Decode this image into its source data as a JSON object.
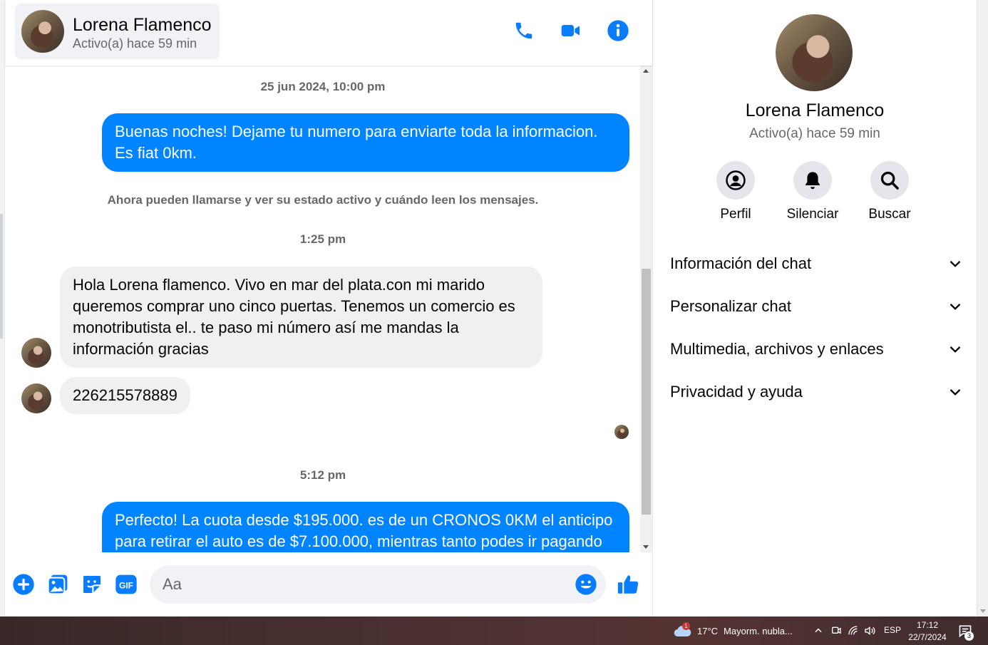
{
  "contact": {
    "name": "Lorena Flamenco",
    "status": "Activo(a) hace 59 min"
  },
  "header": {
    "call_icon": "phone-icon",
    "video_icon": "video-camera-icon",
    "info_icon": "info-icon"
  },
  "messages": {
    "ts1": "25 jun 2024, 10:00 pm",
    "out1_line1": "Buenas noches! Dejame tu numero para enviarte toda la informacion.",
    "out1_line2": "Es fiat 0km.",
    "notice": "Ahora pueden llamarse y ver su estado activo y cuándo leen los mensajes.",
    "ts2": "1:25 pm",
    "in1_line1": "Hola Lorena flamenco. Vivo en mar del plata.con mi marido",
    "in1_line2": "queremos comprar uno cinco puertas. Tenemos un comercio es",
    "in1_line3": "monotributista el.. te paso mi número así me mandas la",
    "in1_line4": "información gracias",
    "in2": "226215578889",
    "ts3": "5:12 pm",
    "out2_line1": "Perfecto! La cuota desde $195.000. es de un CRONOS 0KM el anticipo",
    "out2_line2": "para retirar el auto es de $7.100.000, mientras tanto podes ir pagando"
  },
  "composer": {
    "placeholder": "Aa",
    "icons": [
      "plus-icon",
      "image-icon",
      "sticker-icon",
      "gif-icon",
      "emoji-icon",
      "thumbs-up-icon"
    ],
    "gif_label": "GIF"
  },
  "panel": {
    "actions": [
      {
        "label": "Perfil",
        "icon": "profile-icon"
      },
      {
        "label": "Silenciar",
        "icon": "bell-icon"
      },
      {
        "label": "Buscar",
        "icon": "search-icon"
      }
    ],
    "sections": [
      {
        "label": "Información del chat"
      },
      {
        "label": "Personalizar chat"
      },
      {
        "label": "Multimedia, archivos y enlaces"
      },
      {
        "label": "Privacidad y ayuda"
      }
    ]
  },
  "taskbar": {
    "weather_badge": "1",
    "temperature": "17°C",
    "weather": "Mayorm. nubla...",
    "language": "ESP",
    "time": "17:12",
    "date": "22/7/2024",
    "notifications": "3"
  },
  "colors": {
    "accent": "#0084ff",
    "incoming_bubble": "#f0f0f0",
    "icon_blue": "#0a7cff"
  }
}
